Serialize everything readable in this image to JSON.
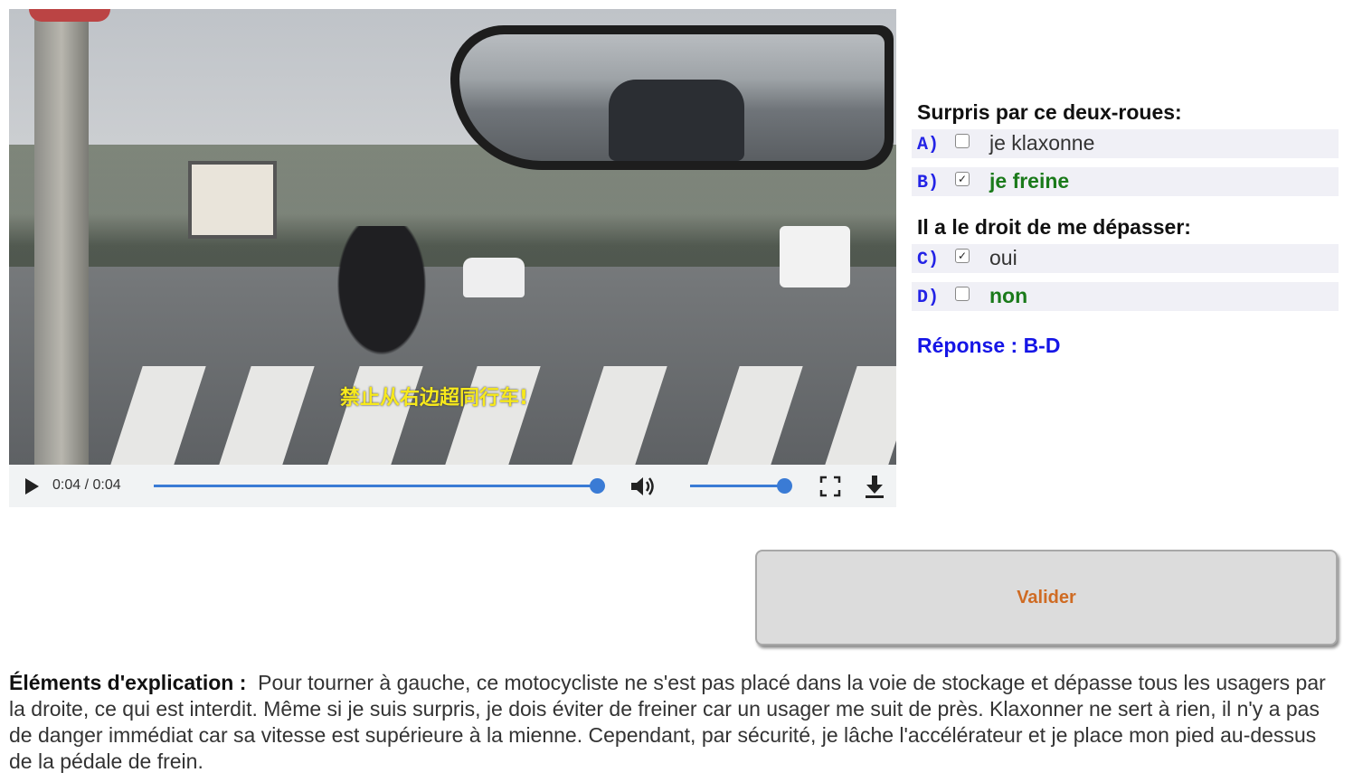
{
  "video": {
    "subtitle": "禁止从右边超同行车!",
    "time": "0:04 / 0:04",
    "progress": 1.0,
    "volume": 1.0
  },
  "quiz": {
    "question1": "Surpris par ce deux-roues:",
    "question2": "Il a le droit de me dépasser:",
    "options": [
      {
        "letter": "A)",
        "text": "je klaxonne",
        "checked": false,
        "correct": false
      },
      {
        "letter": "B)",
        "text": "je freine",
        "checked": true,
        "correct": true
      },
      {
        "letter": "C)",
        "text": "oui",
        "checked": true,
        "correct": false
      },
      {
        "letter": "D)",
        "text": "non",
        "checked": false,
        "correct": true
      }
    ],
    "answer": "Réponse : B-D",
    "validate_label": "Valider"
  },
  "explanation": {
    "label": "Éléments d'explication :",
    "text": "Pour tourner à gauche, ce motocycliste ne s'est pas placé dans la voie de stockage et dépasse tous les usagers par la droite, ce qui est interdit. Même si je suis surpris, je dois éviter de freiner car un usager me suit de près. Klaxonner ne sert à rien, il n'y a pas de danger immédiat car sa vitesse est supérieure à la mienne. Cependant, par sécurité, je lâche l'accélérateur et je place mon pied au-dessus de la pédale de frein."
  },
  "colors": {
    "option_letter": "#2323e6",
    "correct_text": "#1a7a1a",
    "answer_text": "#1515e6",
    "validate_text": "#cf6b23",
    "player_accent": "#3a7bd5",
    "subtitle": "#f7e91c"
  },
  "icons": [
    "play-icon",
    "volume-icon",
    "fullscreen-icon",
    "download-icon",
    "checkbox-icon"
  ]
}
